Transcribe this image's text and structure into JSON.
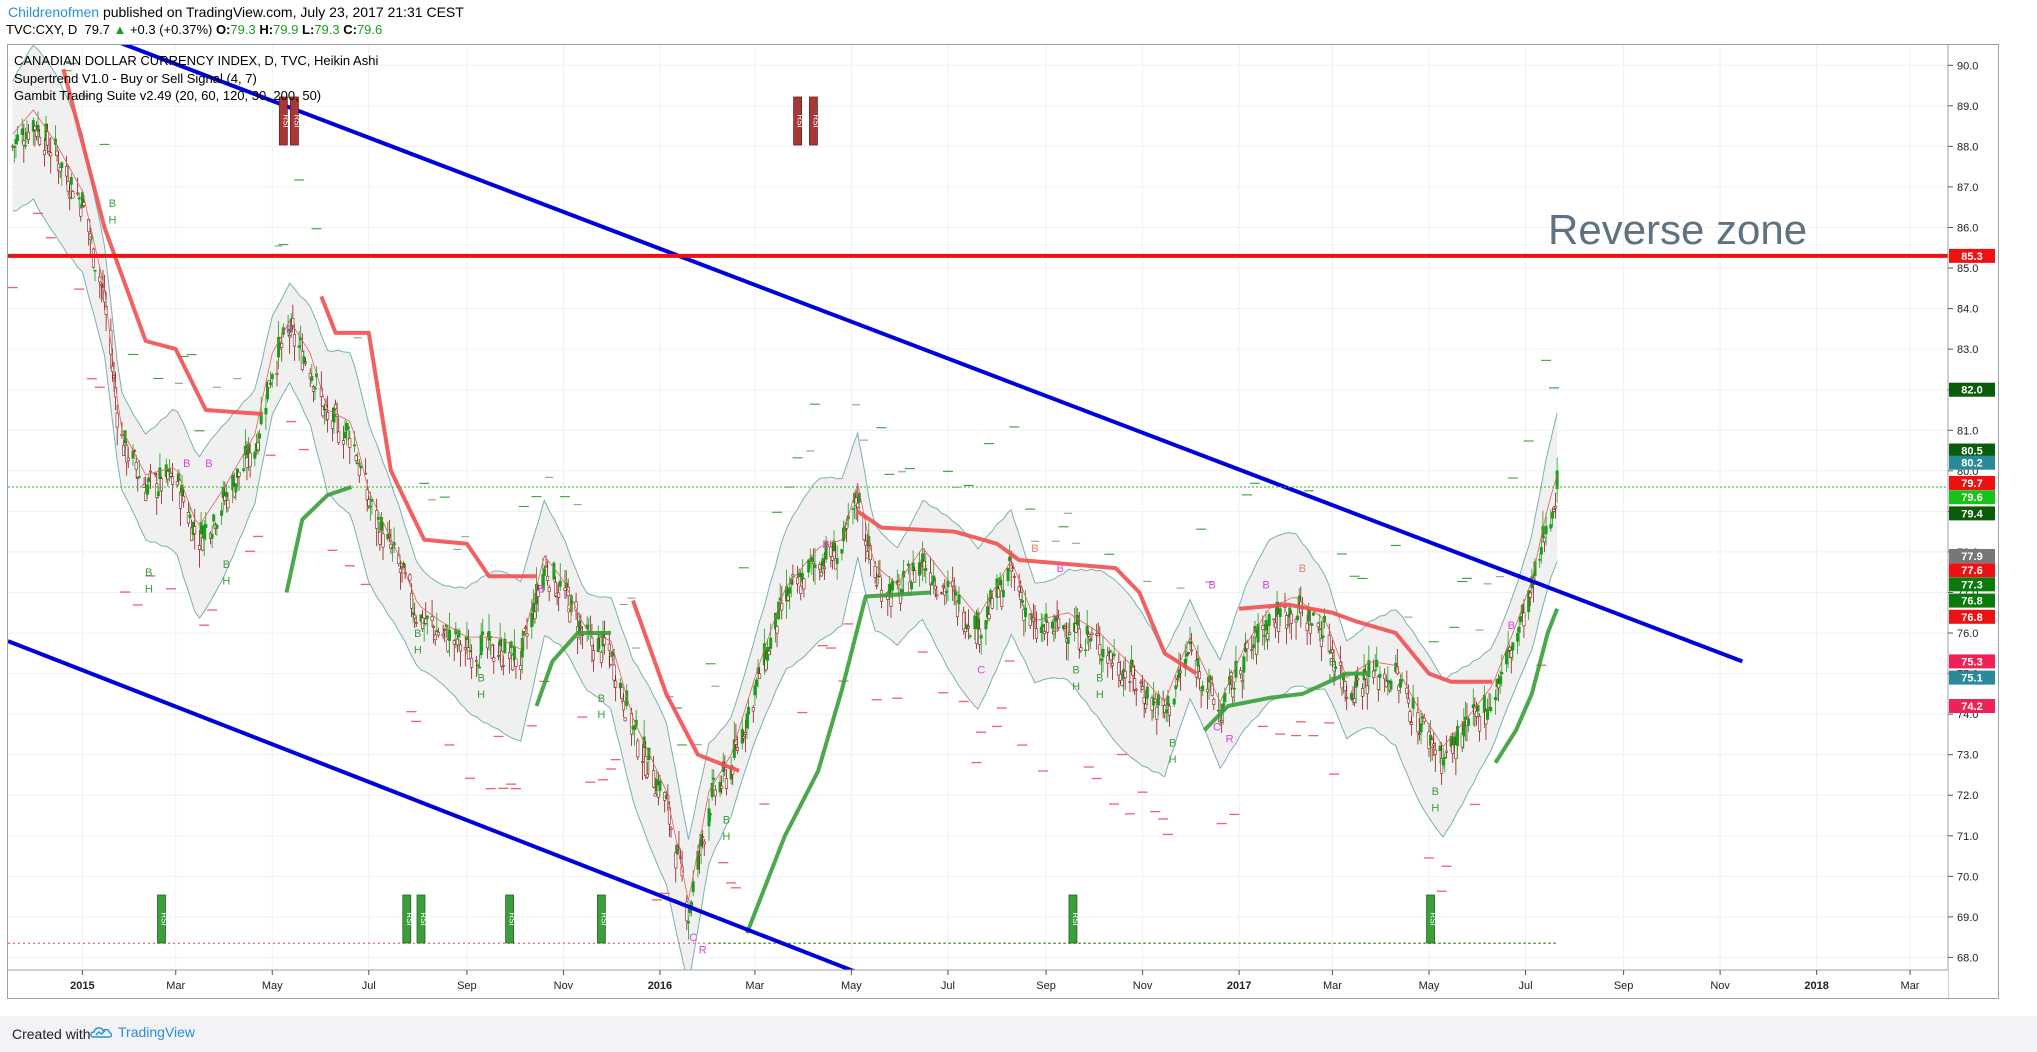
{
  "header": {
    "publisher": "Childrenofmen",
    "published_text": "published on TradingView.com, July 23, 2017 21:31 CEST",
    "symbol": "TVC:CXY, D",
    "open_value": "79.7",
    "change": "+0.3 (+0.37%)",
    "o_label": "O:",
    "o_value": "79.3",
    "h_label": "H:",
    "h_value": "79.9",
    "l_label": "L:",
    "l_value": "79.3",
    "c_label": "C:",
    "c_value": "79.6"
  },
  "legend": {
    "title": "CANADIAN DOLLAR CURRENCY INDEX, D, TVC, Heikin Ashi",
    "indicator1": "Supertrend V1.0 - Buy or Sell Signal (4, 7)",
    "indicator2": "Gambit Trading Suite v2.49 (20, 60, 120, 30, 200, 50)"
  },
  "annotation": {
    "reverse_zone": "Reverse zone"
  },
  "footer": {
    "created_with": "Created with",
    "brand": "TradingView"
  },
  "colors": {
    "price_up": "#1b9e1b",
    "price_down": "#8b1a1a",
    "channel": "#0000dd",
    "resistance": "#ee1111",
    "supertrend_down": "#f05050",
    "supertrend_up": "#3a9e3a",
    "band": "#5f9ea0",
    "brand": "#2a8fd6"
  },
  "chart_data": {
    "type": "candlestick",
    "title": "CANADIAN DOLLAR CURRENCY INDEX, D, TVC, Heikin Ashi",
    "y_axis": {
      "range": [
        67.0,
        90.5
      ],
      "ticks": [
        "68.0",
        "69.0",
        "70.0",
        "71.0",
        "72.0",
        "73.0",
        "74.0",
        "75.0",
        "76.0",
        "77.0",
        "78.0",
        "79.0",
        "80.0",
        "81.0",
        "82.0",
        "83.0",
        "84.0",
        "85.0",
        "86.0",
        "87.0",
        "88.0",
        "89.0",
        "90.0"
      ]
    },
    "x_axis": {
      "ticks": [
        {
          "label": "2015",
          "date": "2015-01-01"
        },
        {
          "label": "Mar",
          "date": "2015-03-01"
        },
        {
          "label": "May",
          "date": "2015-05-01"
        },
        {
          "label": "Jul",
          "date": "2015-07-01"
        },
        {
          "label": "Sep",
          "date": "2015-09-01"
        },
        {
          "label": "Nov",
          "date": "2015-11-01"
        },
        {
          "label": "2016",
          "date": "2016-01-01"
        },
        {
          "label": "Mar",
          "date": "2016-03-01"
        },
        {
          "label": "May",
          "date": "2016-05-01"
        },
        {
          "label": "Jul",
          "date": "2016-07-01"
        },
        {
          "label": "Sep",
          "date": "2016-09-01"
        },
        {
          "label": "Nov",
          "date": "2016-11-01"
        },
        {
          "label": "2017",
          "date": "2017-01-01"
        },
        {
          "label": "Mar",
          "date": "2017-03-01"
        },
        {
          "label": "May",
          "date": "2017-05-01"
        },
        {
          "label": "Jul",
          "date": "2017-07-01"
        },
        {
          "label": "Sep",
          "date": "2017-09-01"
        },
        {
          "label": "Nov",
          "date": "2017-11-01"
        },
        {
          "label": "2018",
          "date": "2018-01-01"
        },
        {
          "label": "Mar",
          "date": "2018-03-01"
        }
      ]
    },
    "x_range": [
      "2014-11-15",
      "2018-03-25"
    ],
    "price_path": [
      [
        "2014-11-18",
        88.0
      ],
      [
        "2014-12-01",
        88.6
      ],
      [
        "2014-12-15",
        87.8
      ],
      [
        "2015-01-01",
        86.6
      ],
      [
        "2015-01-15",
        84.2
      ],
      [
        "2015-01-25",
        80.8
      ],
      [
        "2015-02-10",
        79.6
      ],
      [
        "2015-03-01",
        79.8
      ],
      [
        "2015-03-15",
        78.3
      ],
      [
        "2015-04-01",
        79.3
      ],
      [
        "2015-04-20",
        80.6
      ],
      [
        "2015-05-01",
        82.6
      ],
      [
        "2015-05-12",
        83.4
      ],
      [
        "2015-05-25",
        82.6
      ],
      [
        "2015-06-05",
        81.2
      ],
      [
        "2015-06-20",
        80.9
      ],
      [
        "2015-07-01",
        79.2
      ],
      [
        "2015-07-20",
        77.6
      ],
      [
        "2015-08-01",
        76.4
      ],
      [
        "2015-08-15",
        76.0
      ],
      [
        "2015-09-01",
        75.6
      ],
      [
        "2015-09-20",
        75.6
      ],
      [
        "2015-10-05",
        75.3
      ],
      [
        "2015-10-20",
        77.6
      ],
      [
        "2015-11-01",
        77.0
      ],
      [
        "2015-11-15",
        75.8
      ],
      [
        "2015-12-01",
        75.5
      ],
      [
        "2015-12-15",
        73.6
      ],
      [
        "2016-01-05",
        71.8
      ],
      [
        "2016-01-19",
        69.1
      ],
      [
        "2016-02-01",
        71.8
      ],
      [
        "2016-02-15",
        72.7
      ],
      [
        "2016-03-01",
        74.6
      ],
      [
        "2016-03-20",
        76.8
      ],
      [
        "2016-04-10",
        77.8
      ],
      [
        "2016-04-25",
        78.0
      ],
      [
        "2016-05-05",
        79.4
      ],
      [
        "2016-05-15",
        77.4
      ],
      [
        "2016-05-30",
        76.9
      ],
      [
        "2016-06-15",
        77.8
      ],
      [
        "2016-07-01",
        77.0
      ],
      [
        "2016-07-20",
        76.1
      ],
      [
        "2016-08-10",
        77.5
      ],
      [
        "2016-08-25",
        76.0
      ],
      [
        "2016-09-15",
        76.2
      ],
      [
        "2016-10-05",
        75.7
      ],
      [
        "2016-10-25",
        74.9
      ],
      [
        "2016-11-15",
        74.0
      ],
      [
        "2016-12-01",
        75.6
      ],
      [
        "2016-12-20",
        74.0
      ],
      [
        "2017-01-05",
        75.4
      ],
      [
        "2017-01-20",
        76.3
      ],
      [
        "2017-02-05",
        76.6
      ],
      [
        "2017-02-25",
        76.0
      ],
      [
        "2017-03-10",
        74.6
      ],
      [
        "2017-03-25",
        75.0
      ],
      [
        "2017-04-10",
        74.9
      ],
      [
        "2017-04-25",
        73.8
      ],
      [
        "2017-05-10",
        72.9
      ],
      [
        "2017-05-25",
        73.6
      ],
      [
        "2017-06-10",
        74.4
      ],
      [
        "2017-06-25",
        75.9
      ],
      [
        "2017-07-05",
        77.0
      ],
      [
        "2017-07-15",
        78.8
      ],
      [
        "2017-07-21",
        79.6
      ]
    ],
    "supertrend_down": [
      [
        [
          "2014-12-20",
          89.9
        ],
        [
          "2015-01-15",
          86.0
        ],
        [
          "2015-02-10",
          83.2
        ],
        [
          "2015-03-01",
          83.0
        ],
        [
          "2015-03-20",
          81.5
        ],
        [
          "2015-04-25",
          81.4
        ]
      ],
      [
        [
          "2015-06-01",
          84.3
        ],
        [
          "2015-06-10",
          83.4
        ],
        [
          "2015-07-01",
          83.4
        ],
        [
          "2015-07-15",
          80.0
        ],
        [
          "2015-08-05",
          78.3
        ],
        [
          "2015-09-01",
          78.2
        ],
        [
          "2015-09-15",
          77.4
        ],
        [
          "2015-10-15",
          77.4
        ]
      ],
      [
        [
          "2015-12-15",
          76.8
        ],
        [
          "2016-01-05",
          74.5
        ],
        [
          "2016-01-25",
          73.0
        ],
        [
          "2016-02-20",
          72.6
        ]
      ],
      [
        [
          "2016-05-05",
          79.0
        ],
        [
          "2016-05-20",
          78.6
        ],
        [
          "2016-07-05",
          78.5
        ],
        [
          "2016-08-01",
          78.2
        ],
        [
          "2016-08-15",
          77.8
        ],
        [
          "2016-10-15",
          77.6
        ],
        [
          "2016-10-30",
          77.0
        ],
        [
          "2016-11-15",
          75.5
        ],
        [
          "2016-12-05",
          75.0
        ]
      ],
      [
        [
          "2017-01-01",
          76.6
        ],
        [
          "2017-02-01",
          76.7
        ],
        [
          "2017-03-01",
          76.5
        ],
        [
          "2017-03-15",
          76.3
        ],
        [
          "2017-04-10",
          76.0
        ],
        [
          "2017-05-01",
          75.0
        ],
        [
          "2017-05-15",
          74.8
        ],
        [
          "2017-06-10",
          74.8
        ]
      ]
    ],
    "supertrend_up": [
      [
        [
          "2015-05-10",
          77.0
        ],
        [
          "2015-05-20",
          78.8
        ],
        [
          "2015-06-05",
          79.4
        ],
        [
          "2015-06-20",
          79.6
        ]
      ],
      [
        [
          "2015-10-15",
          74.2
        ],
        [
          "2015-10-25",
          75.3
        ],
        [
          "2015-11-10",
          76.0
        ],
        [
          "2015-12-01",
          76.0
        ]
      ],
      [
        [
          "2016-02-25",
          68.6
        ],
        [
          "2016-03-05",
          69.5
        ],
        [
          "2016-03-20",
          71.0
        ],
        [
          "2016-04-10",
          72.6
        ],
        [
          "2016-04-25",
          74.6
        ],
        [
          "2016-05-10",
          76.9
        ],
        [
          "2016-06-20",
          77.0
        ]
      ],
      [
        [
          "2016-12-10",
          73.6
        ],
        [
          "2016-12-25",
          74.2
        ],
        [
          "2017-01-20",
          74.4
        ],
        [
          "2017-02-10",
          74.5
        ],
        [
          "2017-03-10",
          75.0
        ],
        [
          "2017-03-25",
          75.0
        ]
      ],
      [
        [
          "2017-06-12",
          72.8
        ],
        [
          "2017-06-25",
          73.6
        ],
        [
          "2017-07-05",
          74.5
        ],
        [
          "2017-07-15",
          76.0
        ],
        [
          "2017-07-21",
          76.6
        ]
      ]
    ],
    "channel_upper": [
      [
        "2015-01-15",
        90.7
      ],
      [
        "2017-11-15",
        75.3
      ]
    ],
    "channel_lower": [
      [
        "2014-11-15",
        75.8
      ],
      [
        "2016-06-15",
        67.0
      ]
    ],
    "resistance_level": 85.3,
    "current_price_line": 79.6,
    "price_labels": [
      {
        "value": "85.3",
        "price": 85.3,
        "color": "#ee1111"
      },
      {
        "value": "82.0",
        "price": 82.0,
        "color": "#0a5c0a"
      },
      {
        "value": "80.5",
        "price": 80.5,
        "color": "#0a5c0a"
      },
      {
        "value": "80.2",
        "price": 80.2,
        "color": "#2a8a9a"
      },
      {
        "value": "79.7",
        "price": 79.7,
        "color": "#ee1111"
      },
      {
        "value": "79.6",
        "price": 79.35,
        "color": "#19c219"
      },
      {
        "value": "79.4",
        "price": 78.95,
        "color": "#0a5c0a"
      },
      {
        "value": "77.9",
        "price": 77.9,
        "color": "#777777"
      },
      {
        "value": "77.6",
        "price": 77.55,
        "color": "#ee1111"
      },
      {
        "value": "77.3",
        "price": 77.2,
        "color": "#0a7a0a"
      },
      {
        "value": "76.8",
        "price": 76.8,
        "color": "#0a7a0a"
      },
      {
        "value": "76.8",
        "price": 76.4,
        "color": "#ee1111"
      },
      {
        "value": "75.3",
        "price": 75.3,
        "color": "#ee2255"
      },
      {
        "value": "75.1",
        "price": 74.9,
        "color": "#2a8a9a"
      },
      {
        "value": "74.2",
        "price": 74.2,
        "color": "#ee2255"
      }
    ],
    "signals": [
      {
        "text": "B",
        "date": "2015-03-08",
        "price": 80.1,
        "color": "#e040e0"
      },
      {
        "text": "B",
        "date": "2015-03-22",
        "price": 80.1,
        "color": "#e040e0"
      },
      {
        "text": "B",
        "date": "2015-05-12",
        "price": 83.4,
        "color": "#e040e0"
      },
      {
        "text": "B",
        "date": "2015-10-18",
        "price": 77.0,
        "color": "#e040e0"
      },
      {
        "text": "B",
        "date": "2016-04-15",
        "price": 78.1,
        "color": "#e040e0"
      },
      {
        "text": "B",
        "date": "2016-09-10",
        "price": 77.5,
        "color": "#e040e0"
      },
      {
        "text": "B",
        "date": "2016-12-15",
        "price": 77.1,
        "color": "#e040e0"
      },
      {
        "text": "B",
        "date": "2017-01-18",
        "price": 77.1,
        "color": "#e040e0"
      },
      {
        "text": "B",
        "date": "2017-06-22",
        "price": 76.1,
        "color": "#e040e0"
      },
      {
        "text": "B",
        "date": "2016-08-25",
        "price": 78.0,
        "color": "#e08070"
      },
      {
        "text": "B",
        "date": "2017-02-10",
        "price": 77.5,
        "color": "#e08070"
      },
      {
        "text": "B",
        "date": "2015-11-05",
        "price": 76.5,
        "color": "#e08070"
      },
      {
        "text": "C",
        "date": "2016-01-22",
        "price": 68.4,
        "color": "#e040e0"
      },
      {
        "text": "R",
        "date": "2016-01-28",
        "price": 68.1,
        "color": "#e040e0"
      },
      {
        "text": "C",
        "date": "2016-12-18",
        "price": 73.6,
        "color": "#e040e0"
      },
      {
        "text": "R",
        "date": "2016-12-26",
        "price": 73.3,
        "color": "#e040e0"
      },
      {
        "text": "C",
        "date": "2016-07-22",
        "price": 75.0,
        "color": "#e040e0"
      },
      {
        "text": "B",
        "date": "2015-01-20",
        "price": 86.5,
        "color": "#3a9e3a"
      },
      {
        "text": "H",
        "date": "2015-01-20",
        "price": 86.1,
        "color": "#3a9e3a"
      },
      {
        "text": "B",
        "date": "2015-02-12",
        "price": 77.4,
        "color": "#3a9e3a"
      },
      {
        "text": "H",
        "date": "2015-02-12",
        "price": 77.0,
        "color": "#3a9e3a"
      },
      {
        "text": "B",
        "date": "2015-04-02",
        "price": 77.6,
        "color": "#3a9e3a"
      },
      {
        "text": "H",
        "date": "2015-04-02",
        "price": 77.2,
        "color": "#3a9e3a"
      },
      {
        "text": "B",
        "date": "2015-08-01",
        "price": 75.9,
        "color": "#3a9e3a"
      },
      {
        "text": "H",
        "date": "2015-08-01",
        "price": 75.5,
        "color": "#3a9e3a"
      },
      {
        "text": "B",
        "date": "2015-09-10",
        "price": 74.8,
        "color": "#3a9e3a"
      },
      {
        "text": "H",
        "date": "2015-09-10",
        "price": 74.4,
        "color": "#3a9e3a"
      },
      {
        "text": "B",
        "date": "2015-11-25",
        "price": 74.3,
        "color": "#3a9e3a"
      },
      {
        "text": "H",
        "date": "2015-11-25",
        "price": 73.9,
        "color": "#3a9e3a"
      },
      {
        "text": "B",
        "date": "2016-02-12",
        "price": 71.3,
        "color": "#3a9e3a"
      },
      {
        "text": "H",
        "date": "2016-02-12",
        "price": 70.9,
        "color": "#3a9e3a"
      },
      {
        "text": "B",
        "date": "2016-09-20",
        "price": 75.0,
        "color": "#3a9e3a"
      },
      {
        "text": "H",
        "date": "2016-09-20",
        "price": 74.6,
        "color": "#3a9e3a"
      },
      {
        "text": "B",
        "date": "2016-10-05",
        "price": 74.8,
        "color": "#3a9e3a"
      },
      {
        "text": "H",
        "date": "2016-10-05",
        "price": 74.4,
        "color": "#3a9e3a"
      },
      {
        "text": "B",
        "date": "2016-11-20",
        "price": 73.2,
        "color": "#3a9e3a"
      },
      {
        "text": "H",
        "date": "2016-11-20",
        "price": 72.8,
        "color": "#3a9e3a"
      },
      {
        "text": "B",
        "date": "2017-03-01",
        "price": 75.2,
        "color": "#3a9e3a"
      },
      {
        "text": "H",
        "date": "2017-03-01",
        "price": 74.8,
        "color": "#3a9e3a"
      },
      {
        "text": "B",
        "date": "2017-05-05",
        "price": 72.0,
        "color": "#3a9e3a"
      },
      {
        "text": "H",
        "date": "2017-05-05",
        "price": 71.6,
        "color": "#3a9e3a"
      }
    ],
    "boxes_top": [
      {
        "date": "2015-05-08",
        "text": "RSI"
      },
      {
        "date": "2015-05-15",
        "text": "RSI"
      },
      {
        "date": "2016-03-28",
        "text": "RSI"
      },
      {
        "date": "2016-04-07",
        "text": "RSI"
      }
    ],
    "boxes_bottom": [
      {
        "date": "2015-02-20",
        "text": "RSI"
      },
      {
        "date": "2015-07-25",
        "text": "RSI"
      },
      {
        "date": "2015-08-03",
        "text": "RSI"
      },
      {
        "date": "2015-09-28",
        "text": "RSI"
      },
      {
        "date": "2015-11-25",
        "text": "RSI"
      },
      {
        "date": "2016-09-18",
        "text": "RSI"
      },
      {
        "date": "2017-05-02",
        "text": "RSI"
      }
    ]
  }
}
